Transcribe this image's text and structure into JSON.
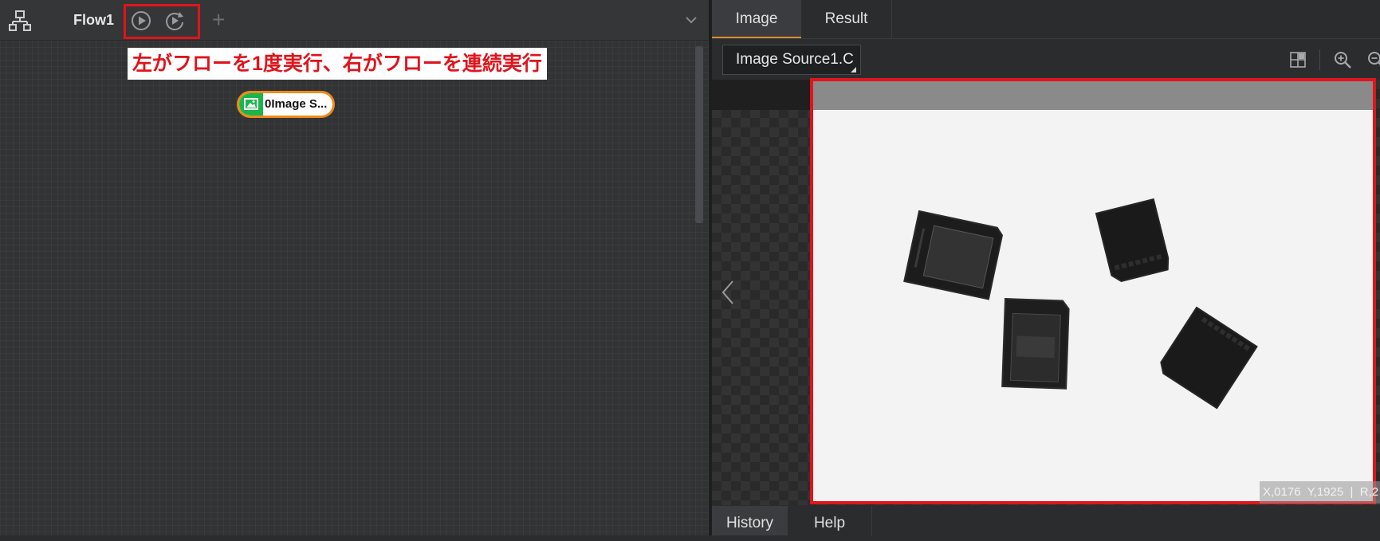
{
  "flow_panel": {
    "tab_title": "Flow1",
    "add_tab_symbol": "+",
    "run_once_icon": "play-circle-icon",
    "run_continuous_icon": "loop-play-icon",
    "annotation": "左がフローを1度実行、右がフローを連続実行",
    "node": {
      "label": "0Image S...",
      "icon": "image-icon"
    }
  },
  "image_panel": {
    "tabs": [
      "Image",
      "Result"
    ],
    "active_tab": "Image",
    "source_select": "Image Source1.C",
    "coordinate_readout": "X,0176  Y,1925  |  R,2"
  },
  "bottom_tabs": [
    "History",
    "Help"
  ],
  "colors": {
    "highlight": "#e0141c",
    "node_border": "#f08a1a",
    "node_icon_bg": "#1ab64a",
    "active_tab_underline": "#d98a2c"
  }
}
